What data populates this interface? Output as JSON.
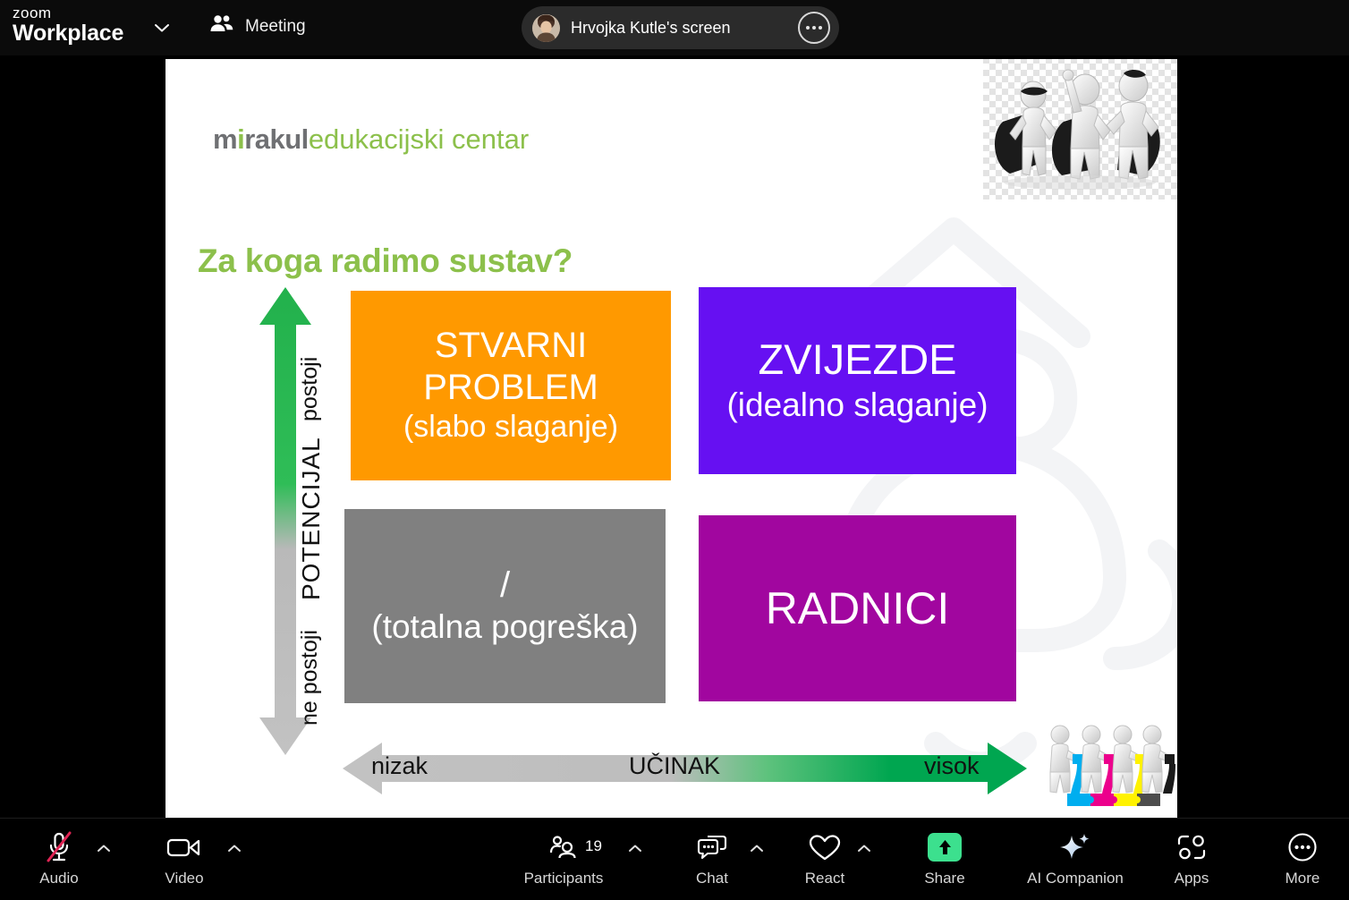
{
  "topbar": {
    "brand_line1": "zoom",
    "brand_line2": "Workplace",
    "brand_caret_icon": "chevron-down-icon",
    "meeting_label": "Meeting",
    "meeting_icon": "participants-icon",
    "share_pill": {
      "label": "Hrvojka Kutle's screen",
      "avatar_icon": "user-avatar",
      "more_icon": "ellipsis-icon"
    }
  },
  "slide": {
    "logo": {
      "part1": "m",
      "part2": "i",
      "part3": "rakul",
      "part4": "edukacijski centar"
    },
    "title": "Za koga radimo sustav?",
    "images": {
      "heroes": "superheroes-image",
      "cmyk": "cmyk-puzzle-figures-image",
      "watermark": "mirakul-watermark"
    },
    "y_axis": {
      "top_label": "postoji",
      "middle_label": "POTENCIJAL",
      "bottom_label": "ne postoji",
      "gradient_top": "#22b14c",
      "gradient_bottom": "#bfbfbf"
    },
    "x_axis": {
      "left_label": "nizak",
      "middle_label": "UČINAK",
      "right_label": "visok",
      "gradient_left": "#bfbfbf",
      "gradient_right": "#00a650"
    },
    "quadrants": [
      {
        "key": "stvarni-problem",
        "line1": "STVARNI",
        "line2": "PROBLEM",
        "subtitle": "(slabo slaganje)",
        "color": "#ff9900"
      },
      {
        "key": "zvijezde",
        "line1": "ZVIJEZDE",
        "subtitle": "(idealno slaganje)",
        "color": "#6610f2"
      },
      {
        "key": "totalna-pogreska",
        "line1": "/",
        "subtitle": "(totalna pogreška)",
        "color": "#808080"
      },
      {
        "key": "radnici",
        "line1": "RADNICI",
        "color": "#a1069f"
      }
    ]
  },
  "toolbar": {
    "items": [
      {
        "label": "Audio",
        "icon": "microphone-muted-icon",
        "caret": true
      },
      {
        "label": "Video",
        "icon": "video-camera-icon",
        "caret": true
      },
      {
        "label": "Participants",
        "icon": "participants-icon",
        "caret": true,
        "count": "19"
      },
      {
        "label": "Chat",
        "icon": "chat-bubble-icon",
        "caret": true
      },
      {
        "label": "React",
        "icon": "heart-icon",
        "caret": true
      },
      {
        "label": "Share",
        "icon": "share-screen-icon",
        "caret": false
      },
      {
        "label": "AI Companion",
        "icon": "ai-sparkle-icon",
        "caret": false
      },
      {
        "label": "Apps",
        "icon": "apps-icon",
        "caret": false
      },
      {
        "label": "More",
        "icon": "ellipsis-circle-icon",
        "caret": false
      }
    ]
  }
}
